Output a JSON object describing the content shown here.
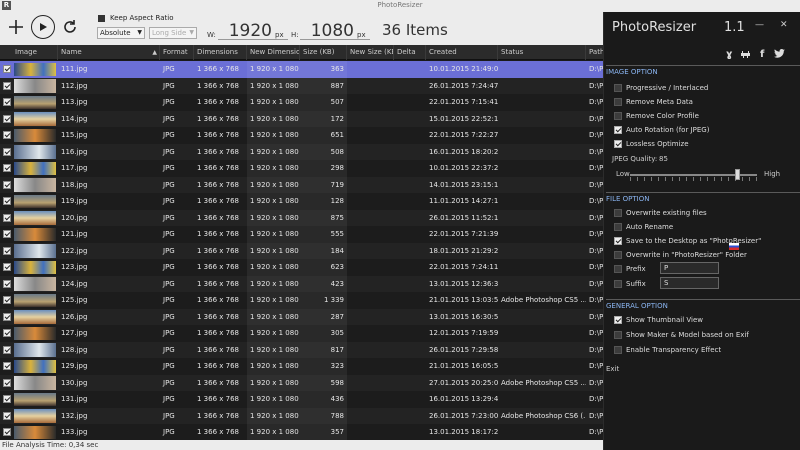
{
  "window": {
    "title": "PhotoResizer",
    "app_icon": "R"
  },
  "toolbar": {
    "keep_aspect_label": "Keep Aspect Ratio",
    "resize_mode": "Absolute",
    "side_mode": "Long Side",
    "width_label": "W:",
    "width_value": "1920",
    "width_unit": "px",
    "height_label": "H:",
    "height_value": "1080",
    "height_unit": "px",
    "items_count": "36 Items"
  },
  "table": {
    "columns": [
      "Image",
      "Name",
      "Format",
      "Dimensions",
      "New Dimensio...",
      "Size (KB)",
      "New Size (KB)",
      "Delta",
      "Created",
      "Status",
      "Path"
    ],
    "rows": [
      {
        "name": "111.jpg",
        "format": "JPG",
        "dim": "1 366 x 768",
        "newdim": "1 920 x 1 080",
        "size": "363",
        "created": "10.01.2015 21:49:03",
        "status": "",
        "path": "D:\\P"
      },
      {
        "name": "112.jpg",
        "format": "JPG",
        "dim": "1 366 x 768",
        "newdim": "1 920 x 1 080",
        "size": "887",
        "created": "26.01.2015 7:24:47",
        "status": "",
        "path": "D:\\P"
      },
      {
        "name": "113.jpg",
        "format": "JPG",
        "dim": "1 366 x 768",
        "newdim": "1 920 x 1 080",
        "size": "507",
        "created": "22.01.2015 7:15:41",
        "status": "",
        "path": "D:\\P"
      },
      {
        "name": "114.jpg",
        "format": "JPG",
        "dim": "1 366 x 768",
        "newdim": "1 920 x 1 080",
        "size": "172",
        "created": "15.01.2015 22:52:14",
        "status": "",
        "path": "D:\\P"
      },
      {
        "name": "115.jpg",
        "format": "JPG",
        "dim": "1 366 x 768",
        "newdim": "1 920 x 1 080",
        "size": "651",
        "created": "22.01.2015 7:22:27",
        "status": "",
        "path": "D:\\P"
      },
      {
        "name": "116.jpg",
        "format": "JPG",
        "dim": "1 366 x 768",
        "newdim": "1 920 x 1 080",
        "size": "508",
        "created": "16.01.2015 18:20:27",
        "status": "",
        "path": "D:\\P"
      },
      {
        "name": "117.jpg",
        "format": "JPG",
        "dim": "1 366 x 768",
        "newdim": "1 920 x 1 080",
        "size": "298",
        "created": "10.01.2015 22:37:24",
        "status": "",
        "path": "D:\\P"
      },
      {
        "name": "118.jpg",
        "format": "JPG",
        "dim": "1 366 x 768",
        "newdim": "1 920 x 1 080",
        "size": "719",
        "created": "14.01.2015 23:15:16",
        "status": "",
        "path": "D:\\P"
      },
      {
        "name": "119.jpg",
        "format": "JPG",
        "dim": "1 366 x 768",
        "newdim": "1 920 x 1 080",
        "size": "128",
        "created": "11.01.2015 14:27:17",
        "status": "",
        "path": "D:\\P"
      },
      {
        "name": "120.jpg",
        "format": "JPG",
        "dim": "1 366 x 768",
        "newdim": "1 920 x 1 080",
        "size": "875",
        "created": "26.01.2015 11:52:19",
        "status": "",
        "path": "D:\\P"
      },
      {
        "name": "121.jpg",
        "format": "JPG",
        "dim": "1 366 x 768",
        "newdim": "1 920 x 1 080",
        "size": "555",
        "created": "22.01.2015 7:21:39",
        "status": "",
        "path": "D:\\P"
      },
      {
        "name": "122.jpg",
        "format": "JPG",
        "dim": "1 366 x 768",
        "newdim": "1 920 x 1 080",
        "size": "184",
        "created": "18.01.2015 21:29:26",
        "status": "",
        "path": "D:\\P"
      },
      {
        "name": "123.jpg",
        "format": "JPG",
        "dim": "1 366 x 768",
        "newdim": "1 920 x 1 080",
        "size": "623",
        "created": "22.01.2015 7:24:11",
        "status": "",
        "path": "D:\\P"
      },
      {
        "name": "124.jpg",
        "format": "JPG",
        "dim": "1 366 x 768",
        "newdim": "1 920 x 1 080",
        "size": "423",
        "created": "13.01.2015 12:36:38",
        "status": "",
        "path": "D:\\P"
      },
      {
        "name": "125.jpg",
        "format": "JPG",
        "dim": "1 366 x 768",
        "newdim": "1 920 x 1 080",
        "size": "1 339",
        "created": "21.01.2015 13:03:52",
        "status": "Adobe Photoshop CS5 ...",
        "path": "D:\\P"
      },
      {
        "name": "126.jpg",
        "format": "JPG",
        "dim": "1 366 x 768",
        "newdim": "1 920 x 1 080",
        "size": "287",
        "created": "13.01.2015 16:30:51",
        "status": "",
        "path": "D:\\P"
      },
      {
        "name": "127.jpg",
        "format": "JPG",
        "dim": "1 366 x 768",
        "newdim": "1 920 x 1 080",
        "size": "305",
        "created": "12.01.2015 7:19:59",
        "status": "",
        "path": "D:\\P"
      },
      {
        "name": "128.jpg",
        "format": "JPG",
        "dim": "1 366 x 768",
        "newdim": "1 920 x 1 080",
        "size": "817",
        "created": "26.01.2015 7:29:58",
        "status": "",
        "path": "D:\\P"
      },
      {
        "name": "129.jpg",
        "format": "JPG",
        "dim": "1 366 x 768",
        "newdim": "1 920 x 1 080",
        "size": "323",
        "created": "21.01.2015 16:05:59",
        "status": "",
        "path": "D:\\P"
      },
      {
        "name": "130.jpg",
        "format": "JPG",
        "dim": "1 366 x 768",
        "newdim": "1 920 x 1 080",
        "size": "598",
        "created": "27.01.2015 20:25:03",
        "status": "Adobe Photoshop CS5 ...",
        "path": "D:\\P"
      },
      {
        "name": "131.jpg",
        "format": "JPG",
        "dim": "1 366 x 768",
        "newdim": "1 920 x 1 080",
        "size": "436",
        "created": "16.01.2015 13:29:48",
        "status": "",
        "path": "D:\\P"
      },
      {
        "name": "132.jpg",
        "format": "JPG",
        "dim": "1 366 x 768",
        "newdim": "1 920 x 1 080",
        "size": "788",
        "created": "26.01.2015 7:23:00",
        "status": "Adobe Photoshop CS6 (...",
        "path": "D:\\P"
      },
      {
        "name": "133.jpg",
        "format": "JPG",
        "dim": "1 366 x 768",
        "newdim": "1 920 x 1 080",
        "size": "357",
        "created": "13.01.2015 18:17:29",
        "status": "",
        "path": "D:\\P"
      }
    ]
  },
  "statusbar": {
    "text": "File Analysis Time: 0,34 sec"
  },
  "panel": {
    "title": "PhotoResizer",
    "version": "1.1",
    "social": {
      "vk": "Vk",
      "f": "f"
    },
    "image_option": {
      "heading": "IMAGE OPTION",
      "options": [
        {
          "label": "Progressive / Interlaced",
          "checked": false
        },
        {
          "label": "Remove Meta Data",
          "checked": false
        },
        {
          "label": "Remove Color Profile",
          "checked": false
        },
        {
          "label": "Auto Rotation (for JPEG)",
          "checked": true
        },
        {
          "label": "Lossless Optimize",
          "checked": true
        }
      ],
      "quality_label": "JPEG Quality:",
      "quality_value": "85",
      "low_label": "Low",
      "high_label": "High"
    },
    "file_option": {
      "heading": "FILE OPTION",
      "options": [
        {
          "label": "Overwrite existing files",
          "checked": false
        },
        {
          "label": "Auto Rename",
          "checked": false
        },
        {
          "label": "Save to the Desktop as \"PhotoResizer\"",
          "checked": true
        },
        {
          "label": "Overwrite in \"PhotoResizer\" Folder",
          "checked": false
        }
      ],
      "prefix_label": "Prefix",
      "prefix_value": "P",
      "suffix_label": "Suffix",
      "suffix_value": "S"
    },
    "general_option": {
      "heading": "GENERAL OPTION",
      "options": [
        {
          "label": "Show Thumbnail View",
          "checked": true
        },
        {
          "label": "Show Maker & Model based on Exif",
          "checked": false
        },
        {
          "label": "Enable Transparency Effect",
          "checked": false
        }
      ]
    },
    "exit_label": "Exit"
  },
  "colors": {
    "selected_row": "#6b6fd6",
    "section_heading": "#8ab4f0"
  }
}
